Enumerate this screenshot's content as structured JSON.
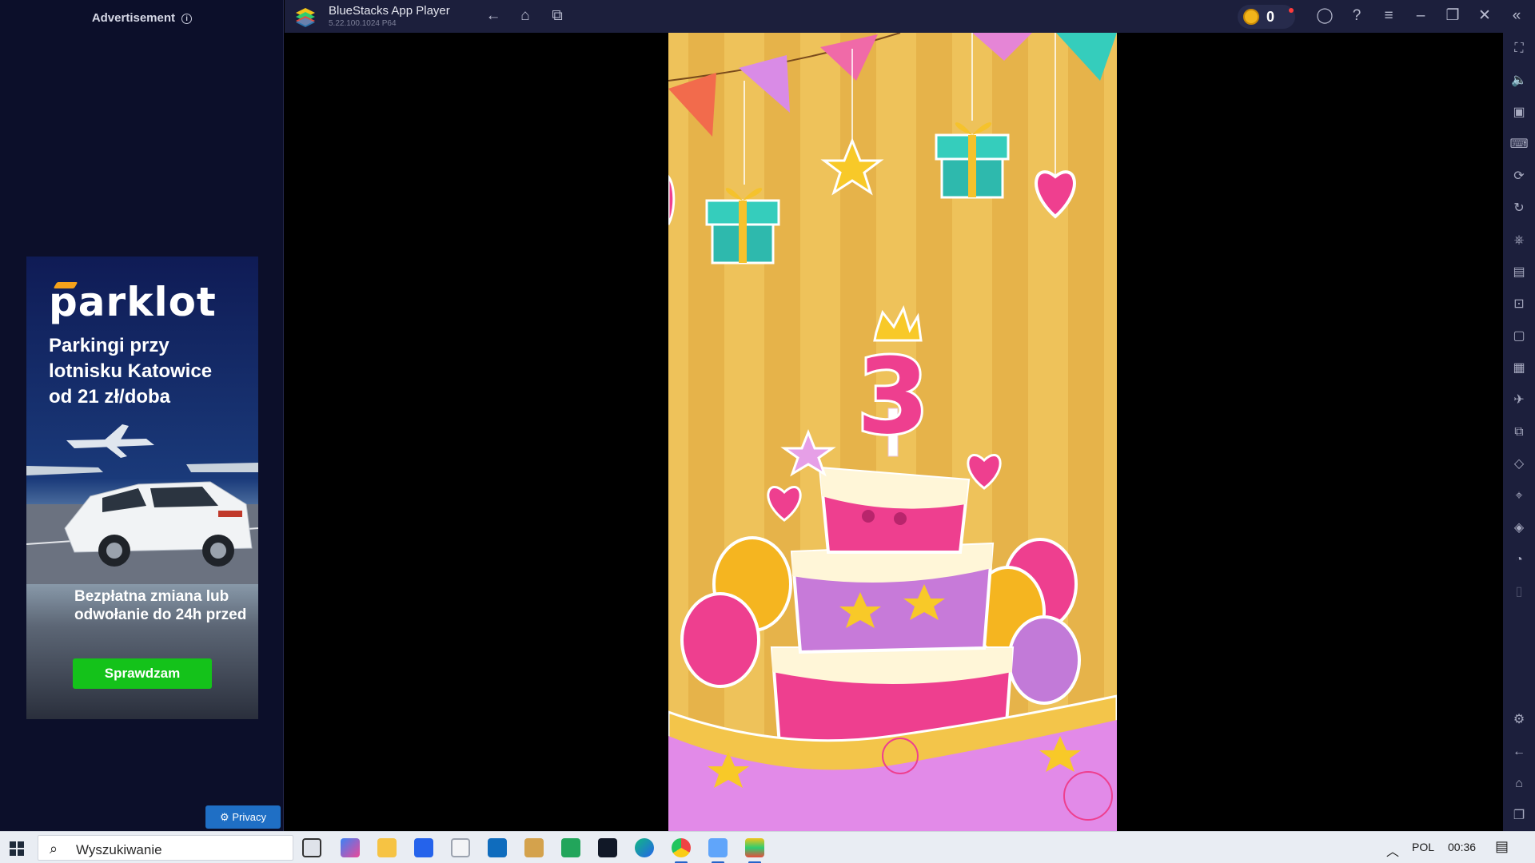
{
  "advertisement": {
    "header": "Advertisement",
    "info_icon": "info-icon",
    "brand": "parklot",
    "headline": "Parkingi przy lotnisku Katowice od 21 zł/doba",
    "subtext": "Bezpłatna zmiana lub odwołanie do 24h przed",
    "cta": "Sprawdzam",
    "privacy": "Privacy"
  },
  "titlebar": {
    "title": "BlueStacks App Player",
    "version": "5.22.100.1024  P64",
    "coins": "0",
    "nav_icons": [
      "back-icon",
      "home-icon",
      "multi-instance-icon"
    ],
    "window_icons": [
      "account-icon",
      "help-icon",
      "menu-icon",
      "minimize-icon",
      "restore-icon",
      "close-icon",
      "collapse-sidebar-icon"
    ]
  },
  "sidebar": {
    "icons": [
      "fullscreen-icon",
      "volume-icon",
      "media-icon",
      "keyboard-icon",
      "macro-icon",
      "rotate-icon",
      "gamepad-icon",
      "apk-icon",
      "screenshot-icon",
      "record-icon",
      "gallery-icon",
      "airplane-icon",
      "multi-instance-icon",
      "eraser-icon",
      "location-icon",
      "layers-icon",
      "eco-mode-icon",
      "panel-icon"
    ],
    "bottom_icons": [
      "settings-icon",
      "back-icon",
      "home-icon",
      "recent-apps-icon"
    ]
  },
  "game": {
    "age_number": "3",
    "colors": {
      "background": "#e6b34a",
      "pink": "#ee3f8f",
      "purple": "#c27ad8",
      "teal": "#34c6c0"
    }
  },
  "taskbar": {
    "search_placeholder": "Wyszukiwanie",
    "language": "POL",
    "time": "00:36",
    "apps": [
      "task-view-icon",
      "copilot-icon",
      "file-explorer-icon",
      "store-icon",
      "home-icon",
      "outlook-icon",
      "app-icon",
      "vpn-icon",
      "photoshop-icon",
      "edge-icon",
      "chrome-icon",
      "photos-icon",
      "bluestacks-icon"
    ]
  }
}
